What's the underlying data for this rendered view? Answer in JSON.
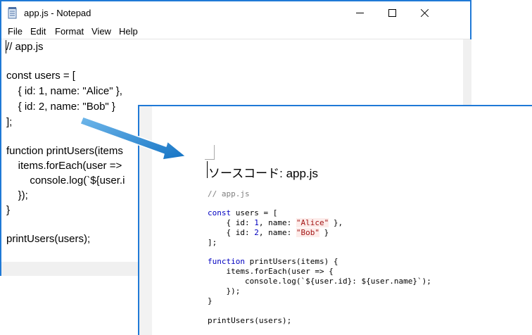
{
  "notepad": {
    "title": "app.js - Notepad",
    "menu": [
      "File",
      "Edit",
      "Format",
      "View",
      "Help"
    ],
    "lines": [
      "// app.js",
      "",
      "const users = [",
      "    { id: 1, name: \"Alice\" },",
      "    { id: 2, name: \"Bob\" }",
      "];",
      "",
      "function printUsers(items",
      "    items.forEach(user =>",
      "        console.log(`${user.i",
      "    });",
      "}",
      "",
      "printUsers(users);"
    ]
  },
  "document": {
    "title": "ソースコード: app.js",
    "code": {
      "comment": "// app.js",
      "l_const_kw": "const",
      "l_const_rest": " users = [",
      "l_row1_a": "    { id: ",
      "l_row1_num": "1",
      "l_row1_b": ", name: ",
      "l_row1_str": "\"Alice\"",
      "l_row1_c": " },",
      "l_row2_a": "    { id: ",
      "l_row2_num": "2",
      "l_row2_b": ", name: ",
      "l_row2_str": "\"Bob\"",
      "l_row2_c": " }",
      "l_close": "];",
      "l_fn_kw": "function",
      "l_fn_rest": " printUsers(items) {",
      "l_foreach": "    items.forEach(user => {",
      "l_log": "        console.log(`${user.id}: ${user.name}`);",
      "l_close_cb": "    });",
      "l_close_fn": "}",
      "l_call": "printUsers(users);"
    }
  },
  "colors": {
    "window_border": "#1f79d6",
    "arrow": "#1e86d0",
    "keyword": "#0000c0",
    "string": "#a31515",
    "comment": "#7f7f7f"
  }
}
